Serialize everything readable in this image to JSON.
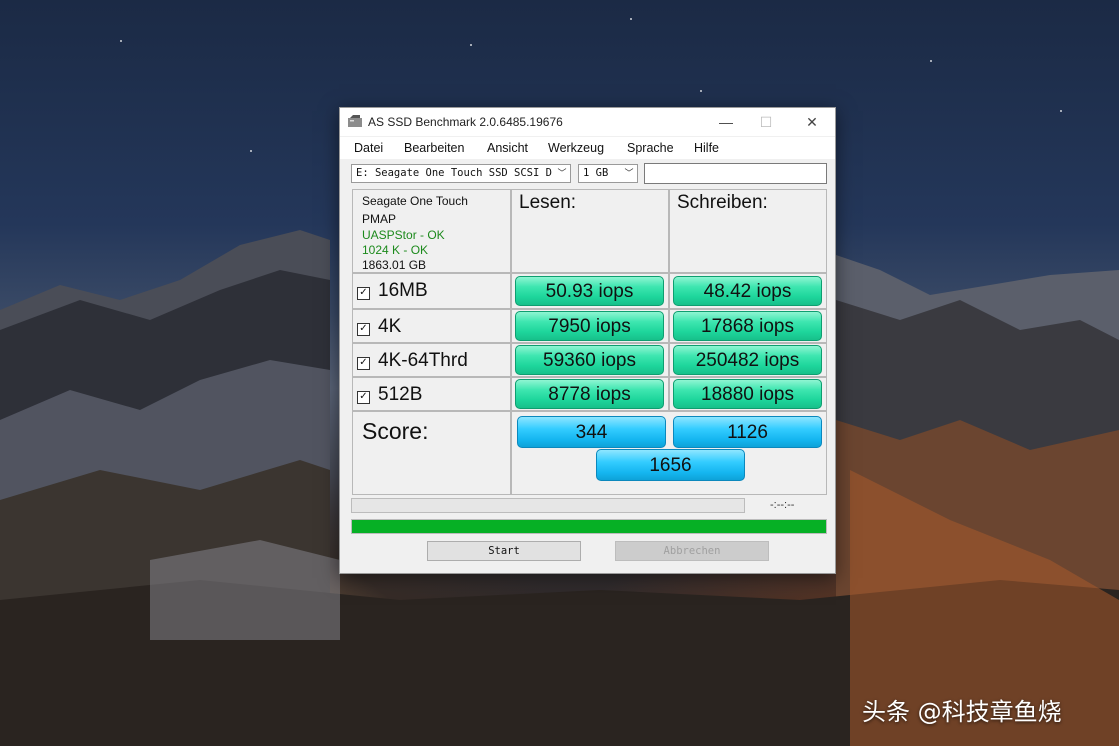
{
  "window": {
    "title": "AS SSD Benchmark 2.0.6485.19676",
    "minimize_glyph": "—",
    "maximize_glyph": "☐",
    "close_glyph": "✕"
  },
  "menu": [
    "Datei",
    "Bearbeiten",
    "Ansicht",
    "Werkzeug",
    "Sprache",
    "Hilfe"
  ],
  "drive_select": {
    "value": "E: Seagate One Touch SSD SCSI Dis",
    "arrow": "﹀"
  },
  "size_select": {
    "value": "1 GB",
    "arrow": "﹀"
  },
  "drive_info": {
    "name": "Seagate One Touch",
    "firmware": "PMAP",
    "driver_status": "UASPStor - OK",
    "alignment_status": "1024 K - OK",
    "capacity": "1863.01 GB"
  },
  "columns": {
    "read": "Lesen:",
    "write": "Schreiben:"
  },
  "check_glyph": "✓",
  "rows": [
    {
      "label": "16MB",
      "read": "50.93 iops",
      "write": "48.42 iops"
    },
    {
      "label": "4K",
      "read": "7950 iops",
      "write": "17868 iops"
    },
    {
      "label": "4K-64Thrd",
      "read": "59360 iops",
      "write": "250482 iops"
    },
    {
      "label": "512B",
      "read": "8778 iops",
      "write": "18880 iops"
    }
  ],
  "score": {
    "label": "Score:",
    "read": "344",
    "write": "1126",
    "total": "1656"
  },
  "progress": {
    "time": "-:--:--",
    "top_fraction": 0,
    "bottom_fraction": 1
  },
  "buttons": {
    "start": "Start",
    "abort": "Abbrechen"
  },
  "watermark": "头条 @科技章鱼烧",
  "colors": {
    "result_green": "#1ed69c",
    "score_blue": "#15b6f0",
    "progress_green": "#06b025"
  }
}
